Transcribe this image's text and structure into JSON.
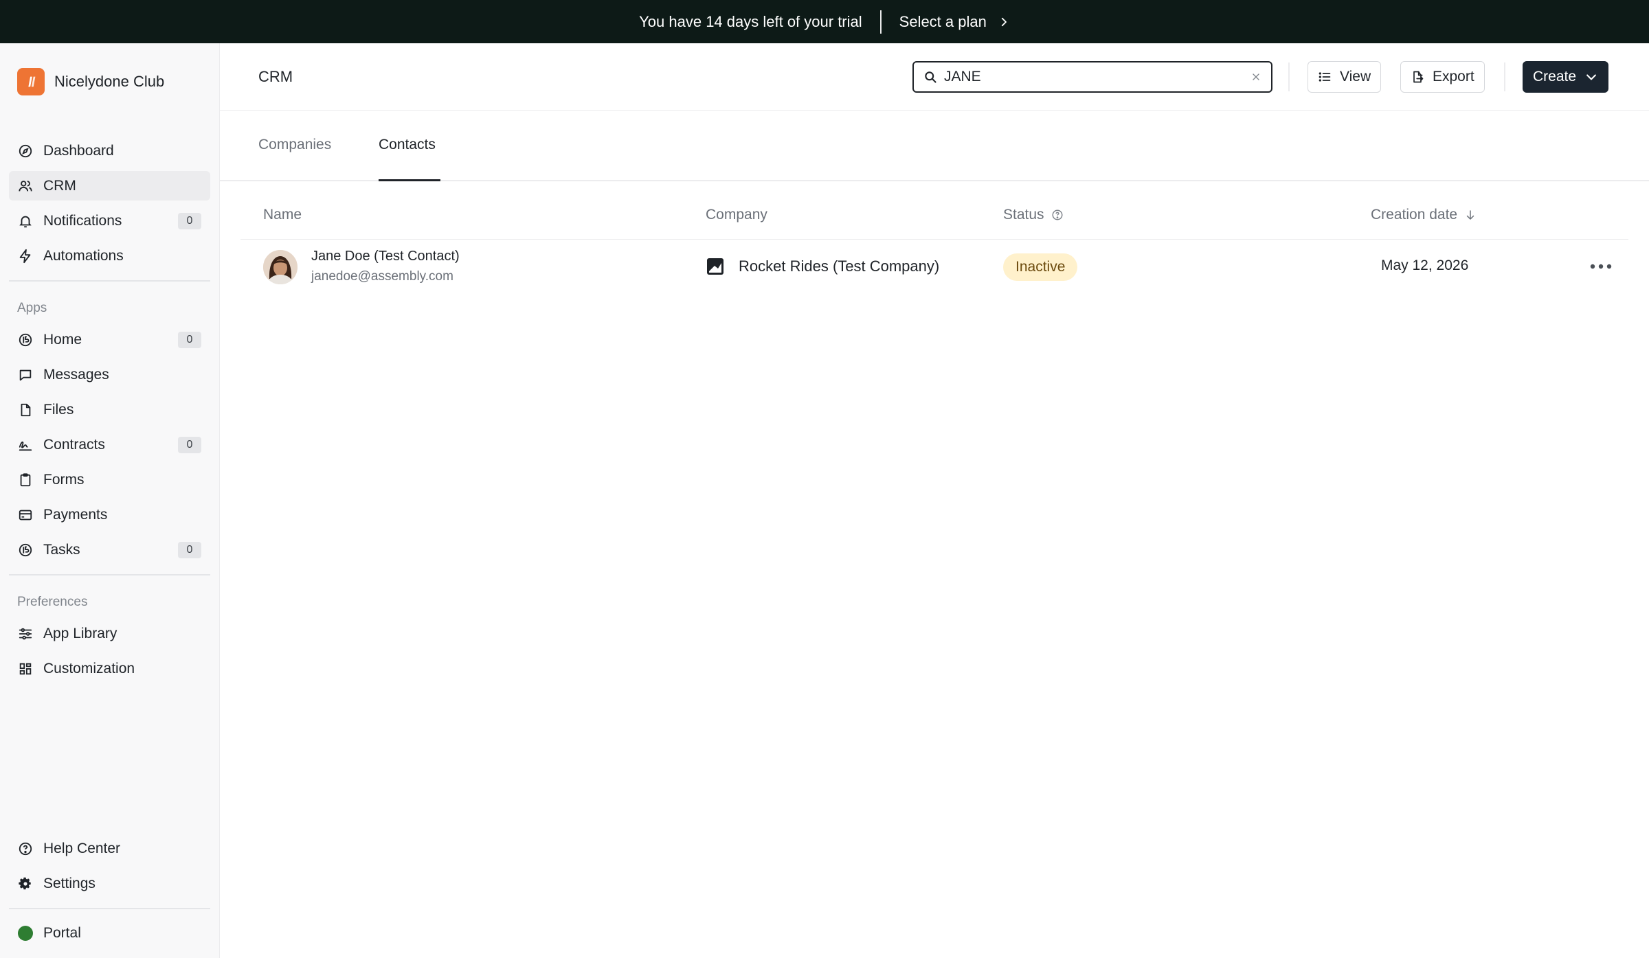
{
  "banner": {
    "trial_text": "You have 14 days left of your trial",
    "plan_link": "Select a plan"
  },
  "brand": {
    "name": "Nicelydone Club",
    "color": "#ee7434"
  },
  "sidebar": {
    "main_items": [
      {
        "label": "Dashboard",
        "icon": "compass-icon"
      },
      {
        "label": "CRM",
        "icon": "users-icon",
        "active": true
      },
      {
        "label": "Notifications",
        "icon": "bell-icon",
        "count": "0"
      },
      {
        "label": "Automations",
        "icon": "bolt-icon"
      }
    ],
    "apps_label": "Apps",
    "app_items": [
      {
        "label": "Home",
        "icon": "home-icon",
        "count": "0"
      },
      {
        "label": "Messages",
        "icon": "chat-icon"
      },
      {
        "label": "Files",
        "icon": "file-icon"
      },
      {
        "label": "Contracts",
        "icon": "signature-icon",
        "count": "0"
      },
      {
        "label": "Forms",
        "icon": "clipboard-icon"
      },
      {
        "label": "Payments",
        "icon": "credit-card-icon"
      },
      {
        "label": "Tasks",
        "icon": "tasks-icon",
        "count": "0"
      }
    ],
    "preferences_label": "Preferences",
    "pref_items": [
      {
        "label": "App Library",
        "icon": "sliders-icon"
      },
      {
        "label": "Customization",
        "icon": "grid-icon"
      }
    ],
    "bottom_items": [
      {
        "label": "Help Center",
        "icon": "help-icon"
      },
      {
        "label": "Settings",
        "icon": "gear-icon"
      }
    ],
    "portal_label": "Portal",
    "portal_color": "#2e7d32"
  },
  "header": {
    "title": "CRM",
    "search_value": "JANE",
    "view_label": "View",
    "export_label": "Export",
    "create_label": "Create"
  },
  "tabs": [
    {
      "label": "Companies"
    },
    {
      "label": "Contacts",
      "active": true
    }
  ],
  "table": {
    "columns": {
      "name": "Name",
      "company": "Company",
      "status": "Status",
      "creation_date": "Creation date"
    },
    "rows": [
      {
        "name": "Jane Doe (Test Contact)",
        "email": "janedoe@assembly.com",
        "company": "Rocket Rides (Test Company)",
        "status": "Inactive",
        "creation_date": "May 12, 2026"
      }
    ]
  }
}
